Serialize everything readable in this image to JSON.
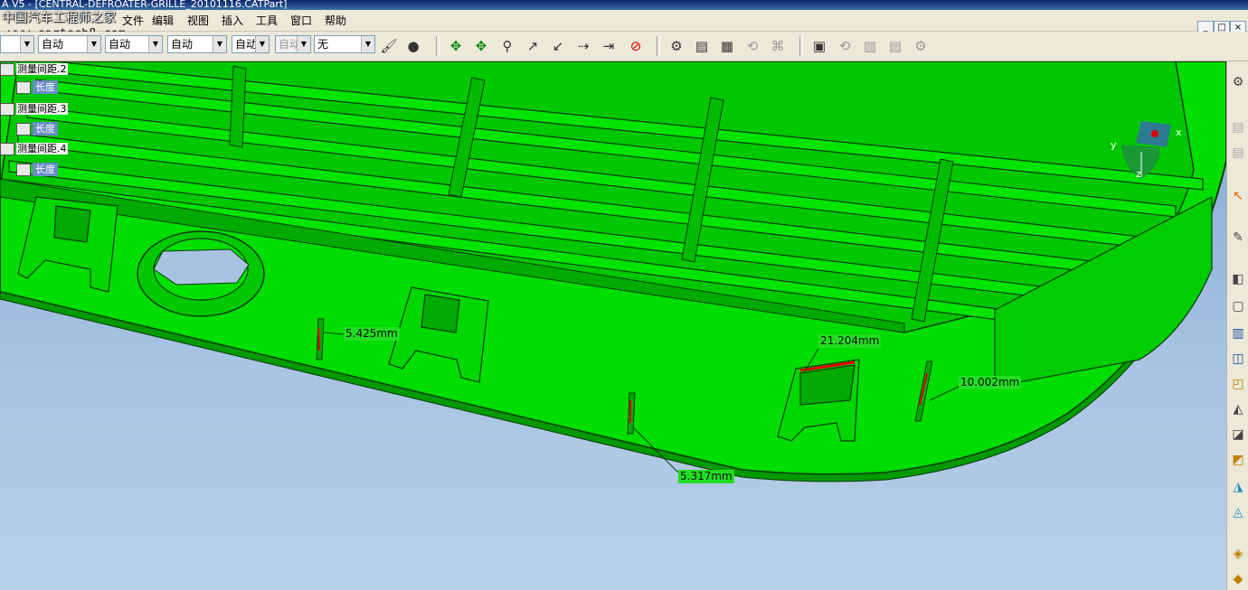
{
  "window": {
    "title": "A V5 - [CENTRAL-DEFROATER-GRILLE_20101116.CATPart]",
    "controls": [
      "_",
      "□",
      "×"
    ]
  },
  "watermark": {
    "cn": "中国汽车工程师之家",
    "url": "www.cartech8.com"
  },
  "menu": {
    "items": [
      "文件",
      "编辑",
      "视图",
      "插入",
      "工具",
      "窗口",
      "帮助"
    ]
  },
  "toolbar": {
    "combos": [
      {
        "value": "",
        "disabled": false
      },
      {
        "value": "自动",
        "disabled": false
      },
      {
        "value": "自动",
        "disabled": false
      },
      {
        "value": "自动",
        "disabled": false
      },
      {
        "value": "自动",
        "disabled": false
      },
      {
        "value": "自动",
        "disabled": true
      },
      {
        "value": "无",
        "disabled": false
      }
    ],
    "icons": [
      "paint-icon",
      "material-icon",
      "move-icon",
      "rotate-icon",
      "snap-icon",
      "compass-icon",
      "normal-view-icon",
      "measure-between-icon",
      "measure-item-icon",
      "measure-inertia-icon",
      "analysis-icon",
      "draft-analysis-icon",
      "curvature-icon",
      "catalog-icon",
      "replace-icon",
      "knowledge-icon",
      "formula-icon",
      "table-icon",
      "rules-icon",
      "check-icon"
    ]
  },
  "tree": {
    "items": [
      {
        "label": "测量间距.2"
      },
      {
        "label": "长度",
        "child": true
      },
      {
        "label": "测量间距.3"
      },
      {
        "label": "长度",
        "child": true
      },
      {
        "label": "测量间距.4"
      },
      {
        "label": "长度",
        "child": true
      }
    ]
  },
  "measurements": [
    {
      "label": "5.425mm"
    },
    {
      "label": "21.204mm"
    },
    {
      "label": "10.002mm"
    },
    {
      "label": "5.317mm"
    }
  ],
  "compass": {
    "axis_x": "x",
    "axis_y": "y",
    "axis_z": "z"
  },
  "colors": {
    "part_green": "#00e000",
    "edge_dark": "#0a3a0a",
    "background_top": "#7ea6d6",
    "background_bottom": "#b7d0e8"
  }
}
